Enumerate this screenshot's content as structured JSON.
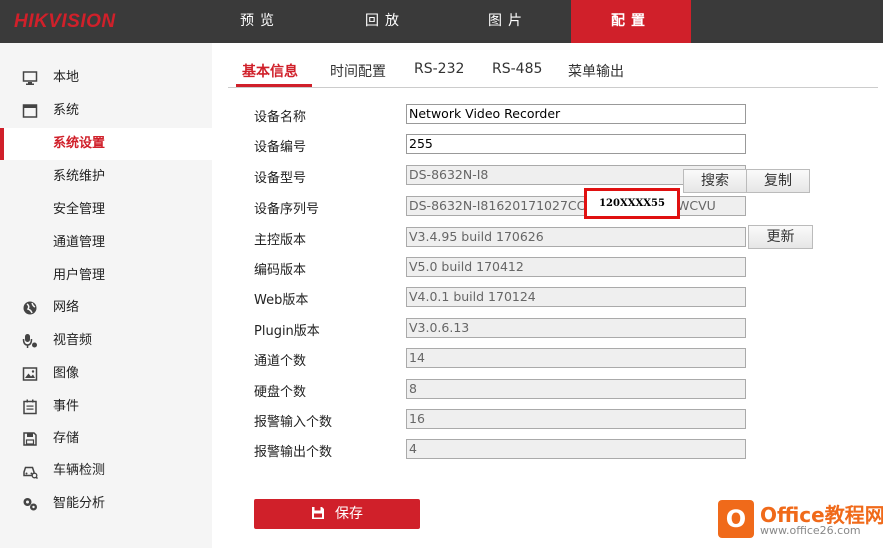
{
  "header": {
    "logo": "HIKVISION",
    "nav": [
      "预览",
      "回放",
      "图片",
      "配置"
    ]
  },
  "sidebar": {
    "items": [
      {
        "label": "本地",
        "icon": "monitor-icon"
      },
      {
        "label": "系统",
        "icon": "window-icon"
      },
      {
        "label": "系统设置",
        "icon": ""
      },
      {
        "label": "系统维护",
        "icon": ""
      },
      {
        "label": "安全管理",
        "icon": ""
      },
      {
        "label": "通道管理",
        "icon": ""
      },
      {
        "label": "用户管理",
        "icon": ""
      },
      {
        "label": "网络",
        "icon": "globe-icon"
      },
      {
        "label": "视音频",
        "icon": "microphone-icon"
      },
      {
        "label": "图像",
        "icon": "image-icon"
      },
      {
        "label": "事件",
        "icon": "calendar-icon"
      },
      {
        "label": "存储",
        "icon": "disk-icon"
      },
      {
        "label": "车辆检测",
        "icon": "car-icon"
      },
      {
        "label": "智能分析",
        "icon": "gears-icon"
      }
    ]
  },
  "tabs": [
    "基本信息",
    "时间配置",
    "RS-232",
    "RS-485",
    "菜单输出"
  ],
  "form": {
    "rows": [
      {
        "label": "设备名称",
        "value": "Network Video Recorder"
      },
      {
        "label": "设备编号",
        "value": "255"
      },
      {
        "label": "设备型号",
        "value": "DS-8632N-I8"
      },
      {
        "label": "设备序列号",
        "value": "DS-8632N-I81620171027CC",
        "value_tail": "WCVU"
      },
      {
        "label": "主控版本",
        "value": "V3.4.95 build 170626"
      },
      {
        "label": "编码版本",
        "value": "V5.0 build 170412"
      },
      {
        "label": "Web版本",
        "value": "V4.0.1 build 170124"
      },
      {
        "label": "Plugin版本",
        "value": "V3.0.6.13"
      },
      {
        "label": "通道个数",
        "value": "14"
      },
      {
        "label": "硬盘个数",
        "value": "8"
      },
      {
        "label": "报警输入个数",
        "value": "16"
      },
      {
        "label": "报警输出个数",
        "value": "4"
      }
    ],
    "search_button": "搜索",
    "copy_button": "复制",
    "update_button": "更新",
    "serial_overlay": "120XXXX55"
  },
  "save_button": "保存",
  "watermark": {
    "title": "Office教程网",
    "url": "www.office26.com",
    "logo_letter": "O"
  },
  "colors": {
    "accent": "#d0202a",
    "topbar": "#3a3a3a",
    "sidebar_bg": "#f5f5f5",
    "watermark_orange": "#f06a1a"
  }
}
